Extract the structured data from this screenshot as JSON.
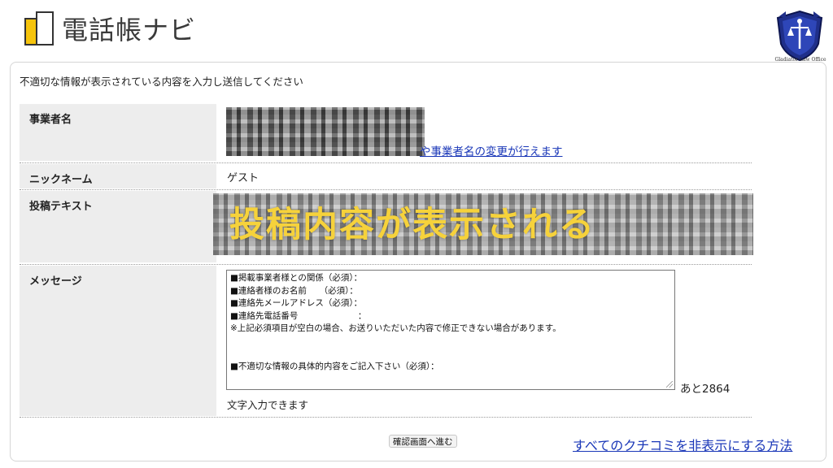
{
  "header": {
    "logo_text": "電話帳ナビ",
    "emblem_caption": "Gladiator Law Office"
  },
  "form": {
    "instruction": "不適切な情報が表示されている内容を入力し送信してください",
    "business": {
      "label": "事業者名",
      "change_link": "や事業者名の変更が行えます"
    },
    "nickname": {
      "label": "ニックネーム",
      "value": "ゲスト"
    },
    "post_text": {
      "label": "投稿テキスト",
      "overlay_caption": "投稿内容が表示される"
    },
    "message": {
      "label": "メッセージ",
      "lines": [
        "■掲載事業者様との関係（必須）：",
        "■連絡者様のお名前　　（必須）：",
        "■連絡先メールアドレス（必須）：",
        "■連絡先電話番号　　　　　　　：",
        "※上記必須項目が空白の場合、お送りいただいた内容で修正できない場合があります。",
        "",
        "",
        "■不適切な情報の具体的内容をご記入下さい（必須）："
      ],
      "counter": "あと2864",
      "hint": "文字入力できます"
    },
    "confirm_button": "確認画面へ進む",
    "hide_all_link": "すべてのクチコミを非表示にする方法"
  }
}
